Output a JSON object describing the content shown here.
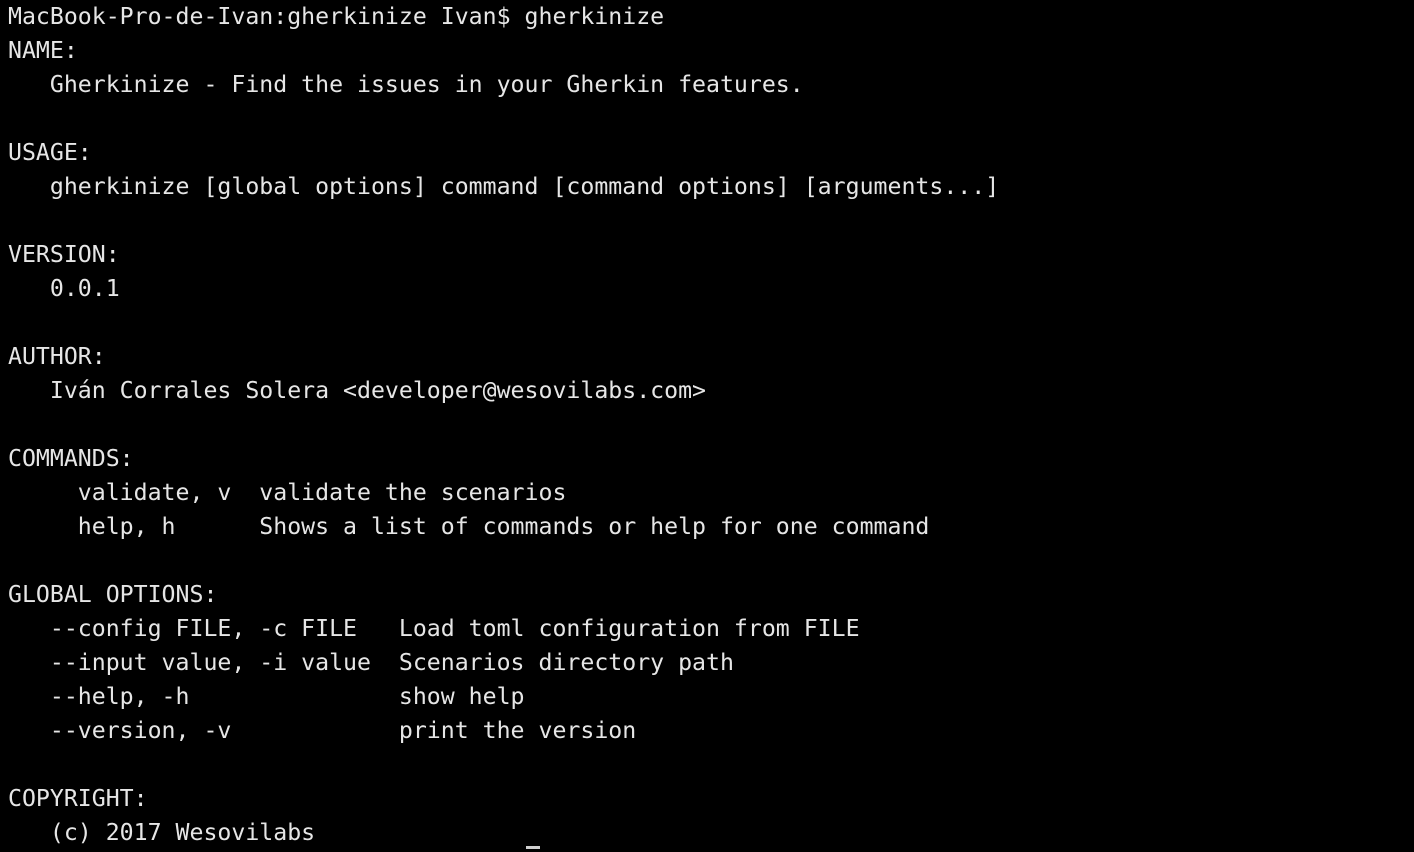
{
  "terminal": {
    "prompt": "MacBook-Pro-de-Ivan:gherkinize Ivan$ gherkinize",
    "lines": [
      "NAME:",
      "   Gherkinize - Find the issues in your Gherkin features.",
      "",
      "USAGE:",
      "   gherkinize [global options] command [command options] [arguments...]",
      "",
      "VERSION:",
      "   0.0.1",
      "",
      "AUTHOR:",
      "   Iván Corrales Solera <developer@wesovilabs.com>",
      "",
      "COMMANDS:",
      "     validate, v  validate the scenarios",
      "     help, h      Shows a list of commands or help for one command",
      "",
      "GLOBAL OPTIONS:",
      "   --config FILE, -c FILE   Load toml configuration from FILE",
      "   --input value, -i value  Scenarios directory path",
      "   --help, -h               show help",
      "   --version, -v            print the version",
      "",
      "COPYRIGHT:",
      "   (c) 2017 Wesovilabs"
    ]
  },
  "colors": {
    "background": "#000000",
    "foreground": "#e6e6e6",
    "cursor": "#cfcfcf"
  }
}
